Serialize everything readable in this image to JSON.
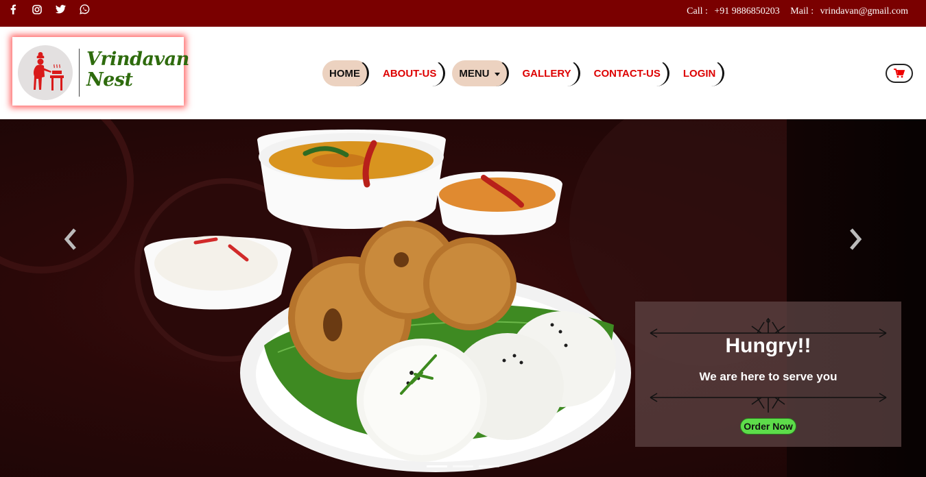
{
  "topbar": {
    "social": [
      {
        "icon": "facebook-icon"
      },
      {
        "icon": "instagram-icon"
      },
      {
        "icon": "twitter-icon"
      },
      {
        "icon": "whatsapp-icon"
      }
    ],
    "call_label": "Call :",
    "phone": "+91 9886850203",
    "mail_label": "Mail :",
    "email": "vrindavan@gmail.com"
  },
  "brand": {
    "line1": "Vrindavan",
    "line2": "Nest",
    "color": "#2e6b0d"
  },
  "nav": {
    "items": [
      {
        "label": "HOME",
        "active": true
      },
      {
        "label": "ABOUT-US"
      },
      {
        "label": "MENU",
        "dropdown": true,
        "active": true
      },
      {
        "label": "GALLERY"
      },
      {
        "label": "CONTACT-US"
      },
      {
        "label": "LOGIN"
      }
    ]
  },
  "cart": {
    "icon": "cart-icon"
  },
  "hero": {
    "title": "Hungry!!",
    "subtitle": "We are here to serve you",
    "cta": "Order Now",
    "slides": 3,
    "active_slide": 1
  },
  "colors": {
    "topbar": "#7a0000",
    "nav_text": "#dd0000",
    "nav_pill": "#ecd2c0",
    "cta": "#5ddc4a"
  }
}
